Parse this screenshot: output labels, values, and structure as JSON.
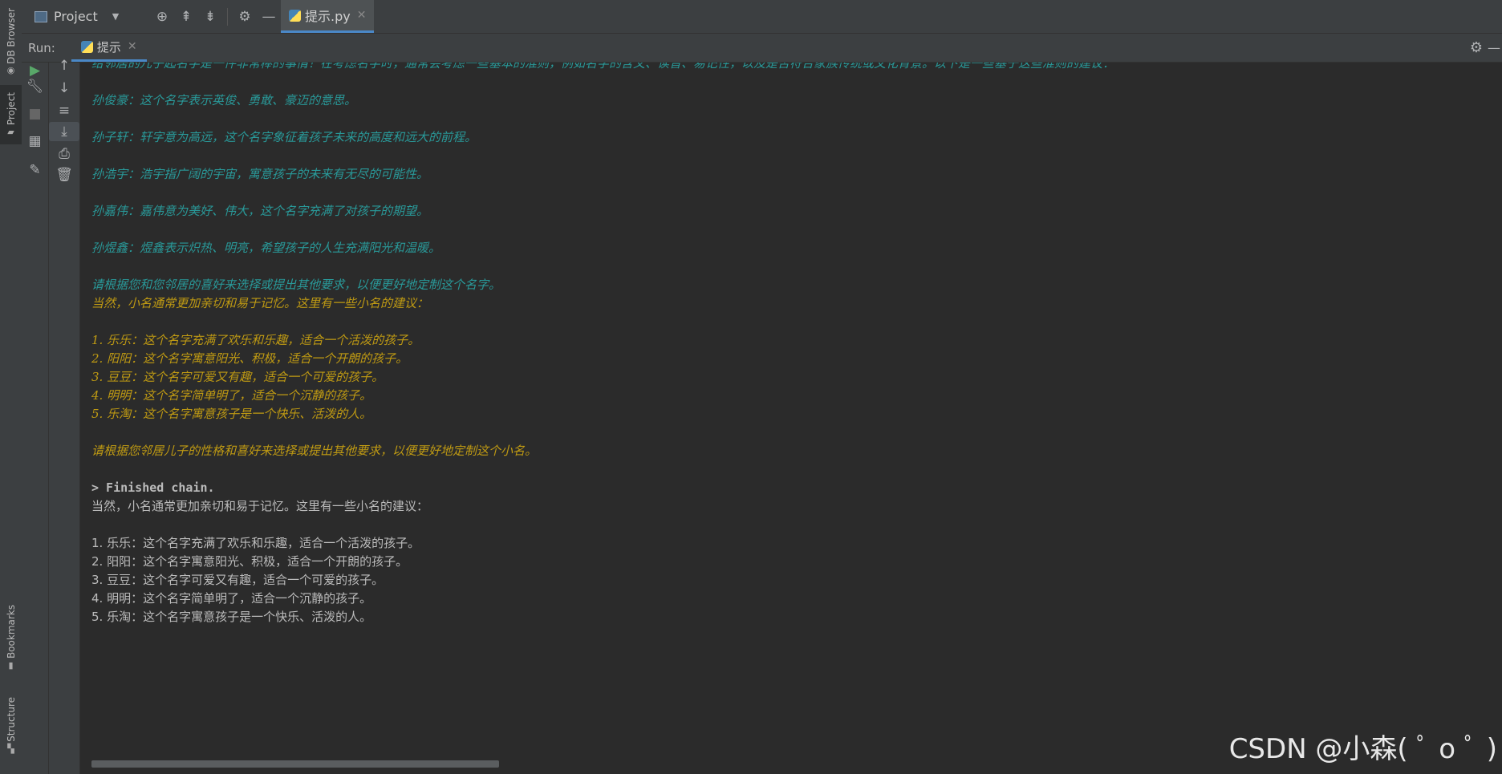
{
  "left_strip": {
    "db_browser": "DB Browser",
    "project": "Project",
    "bookmarks": "Bookmarks",
    "structure": "Structure"
  },
  "top_bar": {
    "project_label": "Project",
    "editor_tab": "提示.py"
  },
  "run_panel": {
    "run_label": "Run:",
    "tab_label": "提示"
  },
  "console": {
    "lines": [
      {
        "text": "给邻居的儿子起名字是一件非常棒的事情！在考虑名字时，通常会考虑一些基本的准则，例如名字的含义、读音、易记性，以及是否符合家族传统或文化背景。以下是一些基于这些准则的建议：",
        "style": "cyan"
      },
      {
        "text": "孙俊豪：这个名字表示英俊、勇敢、豪迈的意思。",
        "style": "cyan"
      },
      {
        "text": "孙子轩：轩字意为高远，这个名字象征着孩子未来的高度和远大的前程。",
        "style": "cyan"
      },
      {
        "text": "孙浩宇：浩宇指广阔的宇宙，寓意孩子的未来有无尽的可能性。",
        "style": "cyan"
      },
      {
        "text": "孙嘉伟：嘉伟意为美好、伟大，这个名字充满了对孩子的期望。",
        "style": "cyan"
      },
      {
        "text": "孙煜鑫：煜鑫表示炽热、明亮，希望孩子的人生充满阳光和温暖。",
        "style": "cyan"
      },
      {
        "text": "请根据您和您邻居的喜好来选择或提出其他要求，以便更好地定制这个名字。",
        "style": "cyan"
      },
      {
        "text": "当然，小名通常更加亲切和易于记忆。这里有一些小名的建议：",
        "style": "gold"
      },
      {
        "text": "1. 乐乐：这个名字充满了欢乐和乐趣，适合一个活泼的孩子。",
        "style": "gold"
      },
      {
        "text": "2. 阳阳：这个名字寓意阳光、积极，适合一个开朗的孩子。",
        "style": "gold"
      },
      {
        "text": "3. 豆豆：这个名字可爱又有趣，适合一个可爱的孩子。",
        "style": "gold"
      },
      {
        "text": "4. 明明：这个名字简单明了，适合一个沉静的孩子。",
        "style": "gold"
      },
      {
        "text": "5. 乐淘：这个名字寓意孩子是一个快乐、活泼的人。",
        "style": "gold"
      },
      {
        "text": "请根据您邻居儿子的性格和喜好来选择或提出其他要求，以便更好地定制这个小名。",
        "style": "gold"
      },
      {
        "text": "> Finished chain.",
        "style": "bold"
      },
      {
        "text": "当然，小名通常更加亲切和易于记忆。这里有一些小名的建议：",
        "style": "plain"
      },
      {
        "text": "1. 乐乐：这个名字充满了欢乐和乐趣，适合一个活泼的孩子。",
        "style": "plain"
      },
      {
        "text": "2. 阳阳：这个名字寓意阳光、积极，适合一个开朗的孩子。",
        "style": "plain"
      },
      {
        "text": "3. 豆豆：这个名字可爱又有趣，适合一个可爱的孩子。",
        "style": "plain"
      },
      {
        "text": "4. 明明：这个名字简单明了，适合一个沉静的孩子。",
        "style": "plain"
      },
      {
        "text": "5. 乐淘：这个名字寓意孩子是一个快乐、活泼的人。",
        "style": "plain"
      }
    ]
  },
  "watermark": "CSDN @小森( ﾟ o ﾟ )",
  "colors": {
    "cyan_output": "#299999",
    "gold_output": "#bf9a13",
    "plain_output": "#bbbbbb",
    "accent": "#4a88c7"
  },
  "icons": [
    "db-icon",
    "folder-icon",
    "bookmark-icon",
    "structure-icon",
    "target-icon",
    "expand-all-icon",
    "collapse-all-icon",
    "gear-icon",
    "minimize-icon",
    "python-file-icon",
    "close-icon",
    "run-icon",
    "wrench-icon",
    "stop-icon",
    "layout-icon",
    "pin-icon",
    "up-arrow-icon",
    "down-arrow-icon",
    "soft-wrap-icon",
    "scroll-to-end-icon",
    "print-icon",
    "trash-icon"
  ]
}
